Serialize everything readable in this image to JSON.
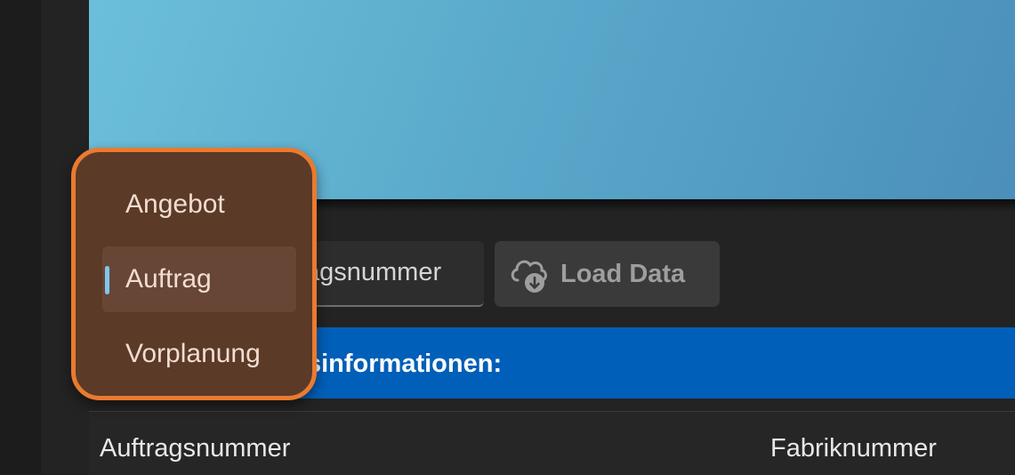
{
  "toolbar": {
    "field_visible_text": "agsnummer",
    "load_button_label": "Load Data"
  },
  "section": {
    "header_visible_text": "sinformationen:"
  },
  "table": {
    "columns": [
      "Auftragsnummer",
      "Fabriknummer"
    ]
  },
  "dropdown": {
    "items": [
      {
        "label": "Angebot",
        "selected": false
      },
      {
        "label": "Auftrag",
        "selected": true
      },
      {
        "label": "Vorplanung",
        "selected": false
      }
    ],
    "highlight_color": "#ea7a30",
    "indicator_color": "#7fc6ef"
  },
  "colors": {
    "accent_blue": "#005fb8",
    "hero_gradient": [
      "#6cbfda",
      "#4b8fba"
    ]
  }
}
